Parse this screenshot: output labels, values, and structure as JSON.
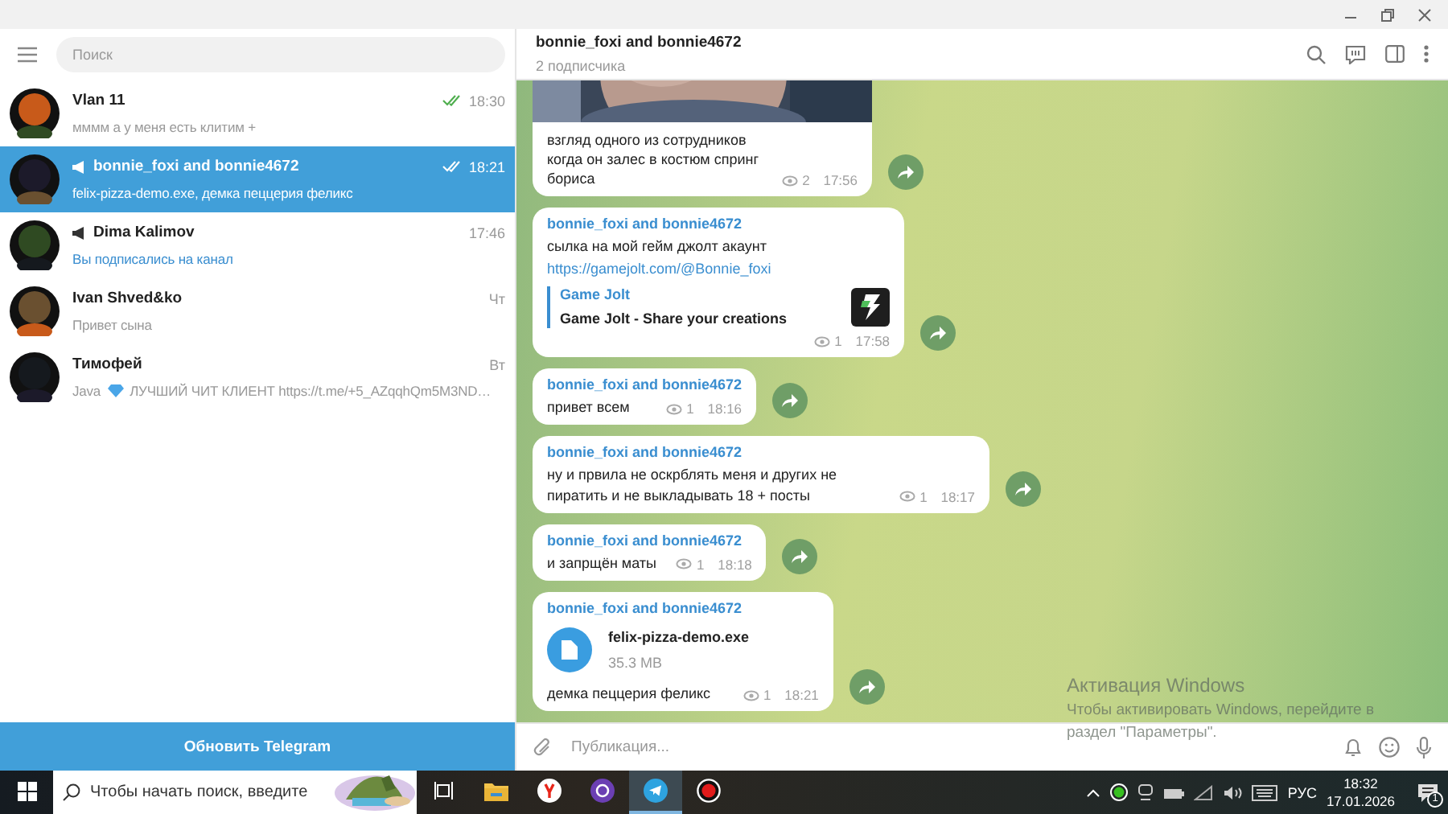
{
  "search": {
    "placeholder": "Поиск"
  },
  "chats": [
    {
      "name": "Vlan 11",
      "preview": "мммм а у меня есть клитим +",
      "time": "18:30",
      "selected": false,
      "channel": false,
      "read": true,
      "service": false
    },
    {
      "name": "bonnie_foxi and bonnie4672",
      "preview": "felix-pizza-demo.exe, демка пеццерия феликс",
      "time": "18:21",
      "selected": true,
      "channel": true,
      "read": true,
      "service": false
    },
    {
      "name": "Dima Kalimov",
      "preview": "Вы подписались на канал",
      "time": "17:46",
      "selected": false,
      "channel": true,
      "read": false,
      "service": true
    },
    {
      "name": "Ivan Shved&ko",
      "preview": "Привет сына",
      "time": "Чт",
      "selected": false,
      "channel": false,
      "read": false,
      "service": false
    },
    {
      "name": "Тимофей",
      "preview_prefix": "Java",
      "preview": "ЛУЧШИЙ ЧИТ КЛИЕНТ https://t.me/+5_AZqqhQm5M3ND…",
      "time": "Вт",
      "selected": false,
      "channel": false,
      "read": false,
      "service": false
    }
  ],
  "update_button": "Обновить Telegram",
  "header": {
    "title": "bonnie_foxi and bonnie4672",
    "subtitle": "2 подписчика"
  },
  "messages": [
    {
      "text": "взгляд одного из сотрудников когда он залес в костюм спринг бориса",
      "views": "2",
      "time": "17:56"
    },
    {
      "kind": "link",
      "author": "bonnie_foxi and bonnie4672",
      "text": "сылка на мой гейм джолт акаунт",
      "link": "https://gamejolt.com/@Bonnie_foxi",
      "site": "Game Jolt",
      "site_title": "Game Jolt - Share your creations",
      "views": "1",
      "time": "17:58"
    },
    {
      "kind": "text",
      "author": "bonnie_foxi and bonnie4672",
      "text": "привет всем",
      "views": "1",
      "time": "18:16"
    },
    {
      "kind": "text",
      "author": "bonnie_foxi and bonnie4672",
      "text": "ну и првила не оскрблять меня и других не пиратить и не выкладывать 18 + посты",
      "views": "1",
      "time": "18:17"
    },
    {
      "kind": "text",
      "author": "bonnie_foxi and bonnie4672",
      "text": "и запрщён маты",
      "views": "1",
      "time": "18:18"
    },
    {
      "kind": "file",
      "author": "bonnie_foxi and bonnie4672",
      "file_name": "felix-pizza-demo.exe",
      "file_size": "35.3 MB",
      "text": "демка пеццерия феликс",
      "views": "1",
      "time": "18:21"
    }
  ],
  "activation": [
    "Активация Windows",
    "Чтобы активировать Windows, перейдите в",
    "раздел \"Параметры\"."
  ],
  "composer": {
    "placeholder": "Публикация..."
  },
  "taskbar": {
    "search_placeholder": "Чтобы начать поиск, введите",
    "apps": [
      {
        "kind": "taskview",
        "selected": false
      },
      {
        "kind": "folder",
        "selected": false
      },
      {
        "kind": "yandex",
        "selected": false
      },
      {
        "kind": "purple",
        "selected": false
      },
      {
        "kind": "telegram",
        "selected": true
      },
      {
        "kind": "record",
        "selected": false
      }
    ],
    "language": "РУС",
    "time": "18:32",
    "date": "17.01.2026",
    "notifications": "1"
  }
}
